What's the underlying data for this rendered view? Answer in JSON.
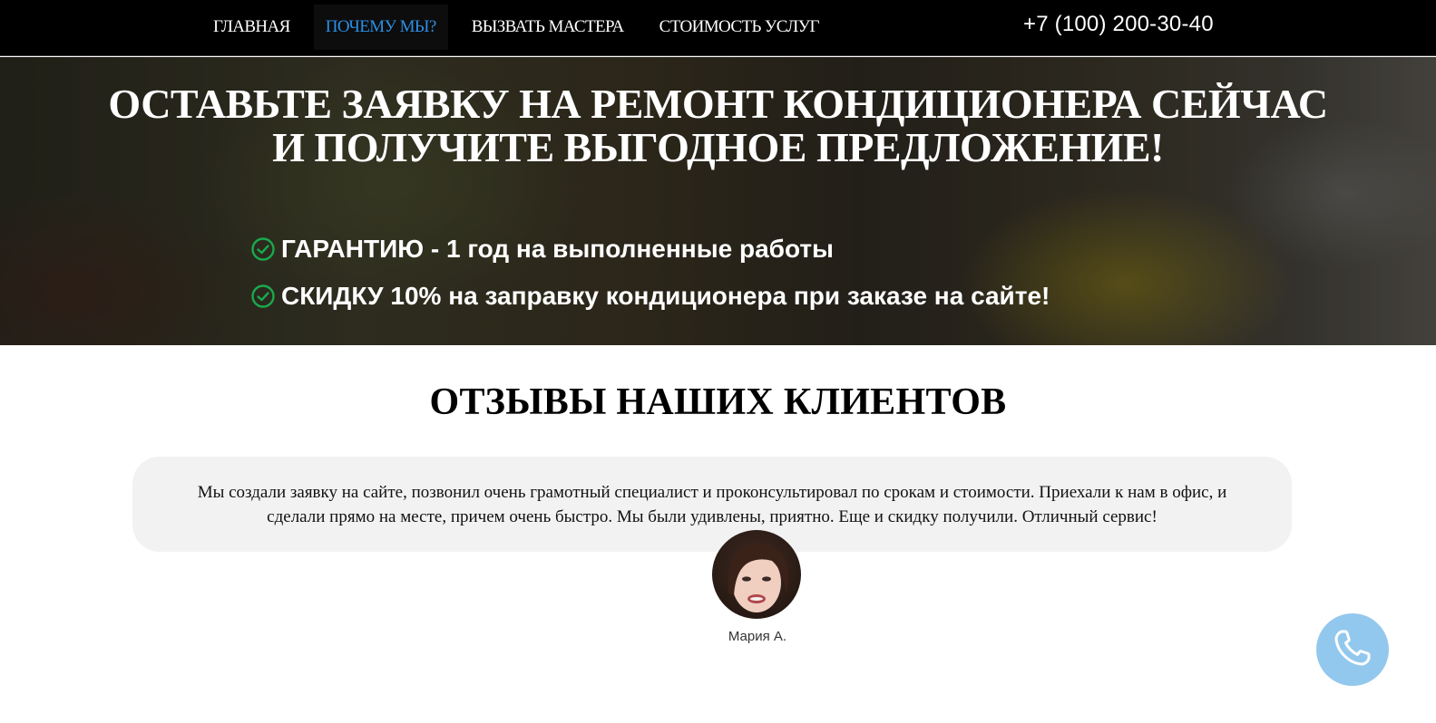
{
  "nav": {
    "items": [
      {
        "label": "ГЛАВНАЯ",
        "active": false
      },
      {
        "label": "ПОЧЕМУ МЫ?",
        "active": true
      },
      {
        "label": "ВЫЗВАТЬ МАСТЕРА",
        "active": false
      },
      {
        "label": "СТОИМОСТЬ УСЛУГ",
        "active": false
      }
    ],
    "phone": "+7 (100) 200-30-40"
  },
  "hero": {
    "title_line1": "ОСТАВЬТЕ ЗАЯВКУ НА РЕМОНТ КОНДИЦИОНЕРА СЕЙЧАС",
    "title_line2": "И ПОЛУЧИТЕ ВЫГОДНОЕ ПРЕДЛОЖЕНИЕ!",
    "bullets": [
      {
        "icon": "check-circle-icon",
        "text": "ГАРАНТИЮ - 1 год на выполненные работы"
      },
      {
        "icon": "check-circle-icon",
        "text": "СКИДКУ 10% на заправку кондиционера при заказе на сайте!"
      }
    ]
  },
  "reviews": {
    "title": "ОТЗЫВЫ НАШИХ КЛИЕНТОВ",
    "items": [
      {
        "text": "Мы создали заявку на сайте, позвонил очень грамотный специалист и проконсультировал по срокам и стоимости. Приехали к нам в офис, и сделали прямо на месте, причем очень быстро. Мы были удивлены, приятно. Еще и скидку получили. Отличный сервис!",
        "author": "Мария А."
      }
    ]
  },
  "call_button": {
    "icon": "phone-icon"
  },
  "colors": {
    "nav_bg": "#000000",
    "nav_active_text": "#2a8fe6",
    "check_green": "#1aa84b",
    "review_card_bg": "#f2f2f2",
    "call_button_bg": "#93c8ee"
  }
}
